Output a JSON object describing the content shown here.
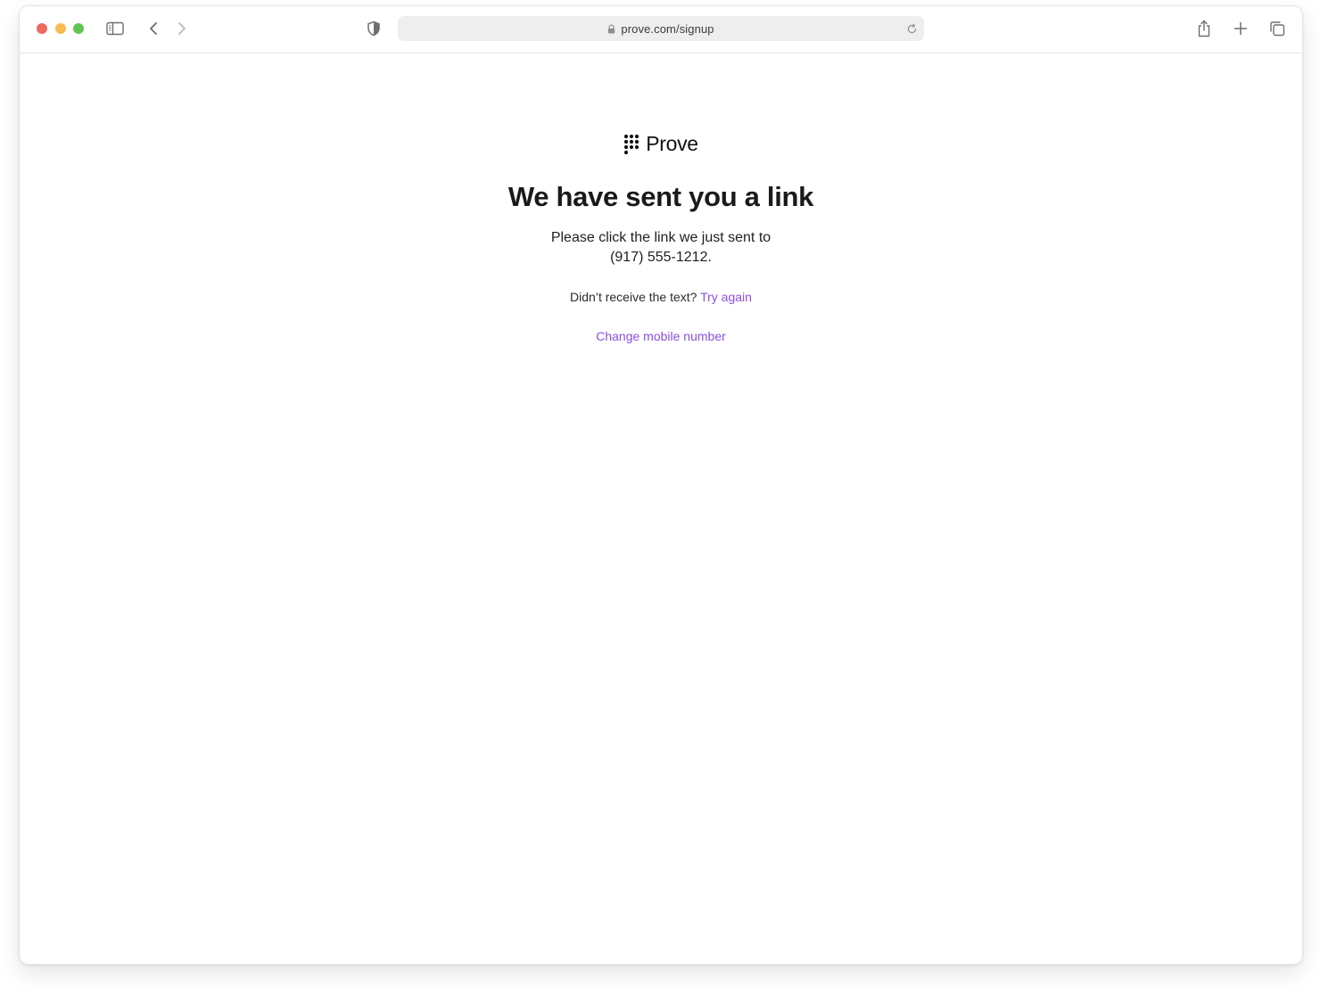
{
  "browser": {
    "url": "prove.com/signup",
    "colors": {
      "close": "#ee6a5f",
      "minimize": "#f5bd4f",
      "zoom": "#61c454"
    }
  },
  "page": {
    "brand": "Prove",
    "headline": "We have sent you a link",
    "instruction": "Please click the link we just sent to",
    "phone": "(917) 555-1212.",
    "retry_prompt": "Didn’t receive the text?",
    "retry_link": "Try again",
    "change_link": "Change mobile number",
    "accent_color": "#8a4fe0"
  }
}
